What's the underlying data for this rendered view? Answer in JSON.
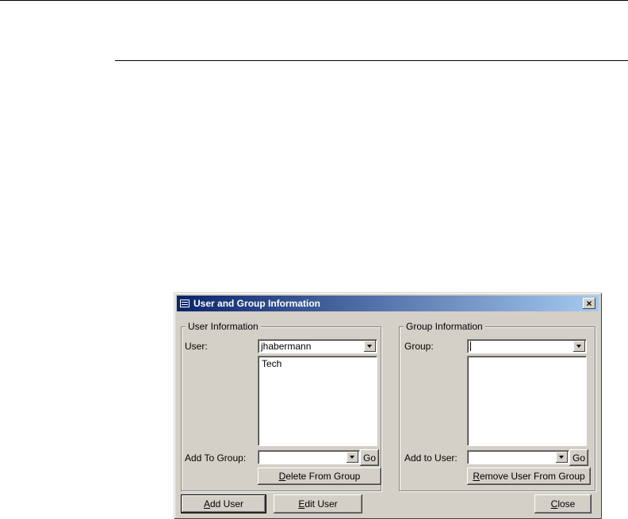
{
  "window": {
    "title": "User and Group Information"
  },
  "user_info": {
    "legend": "User Information",
    "user_label": "User:",
    "user_value": "jhabermann",
    "groups_list": [
      "Tech"
    ],
    "add_to_group_label": "Add To Group:",
    "add_to_group_value": "",
    "go_label": "Go",
    "delete_label_pre": "",
    "delete_label_key": "D",
    "delete_label_post": "elete From Group"
  },
  "group_info": {
    "legend": "Group Information",
    "group_label": "Group:",
    "group_value": "",
    "users_list": [],
    "add_to_user_label": "Add to User:",
    "add_to_user_value": "",
    "go_label": "Go",
    "remove_label_pre": "",
    "remove_label_key": "R",
    "remove_label_post": "emove User From Group"
  },
  "footer": {
    "add_user_key": "A",
    "add_user_rest": "dd User",
    "edit_user_key": "E",
    "edit_user_rest": "dit User",
    "close_key": "C",
    "close_rest": "lose"
  },
  "icons": {
    "close": "×",
    "dropdown": "triangle-down",
    "app": "form-icon"
  }
}
